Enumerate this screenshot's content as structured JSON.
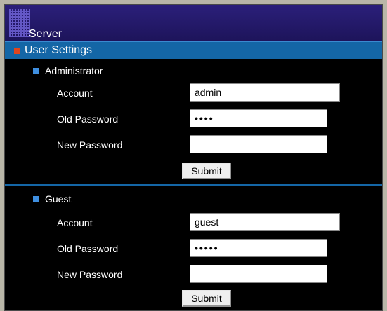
{
  "window": {
    "title": "Server"
  },
  "section": {
    "label": "User Settings",
    "icon": "orange-square-icon",
    "accent": "#1466a6"
  },
  "administrator": {
    "label": "Administrator",
    "account_label": "Account",
    "account_value": "admin",
    "old_password_label": "Old Password",
    "old_password_value": "••••",
    "new_password_label": "New Password",
    "new_password_value": "",
    "submit_label": "Submit"
  },
  "guest": {
    "label": "Guest",
    "account_label": "Account",
    "account_value": "guest",
    "old_password_label": "Old Password",
    "old_password_value": "•••••",
    "new_password_label": "New Password",
    "new_password_value": "",
    "submit_label": "Submit"
  }
}
